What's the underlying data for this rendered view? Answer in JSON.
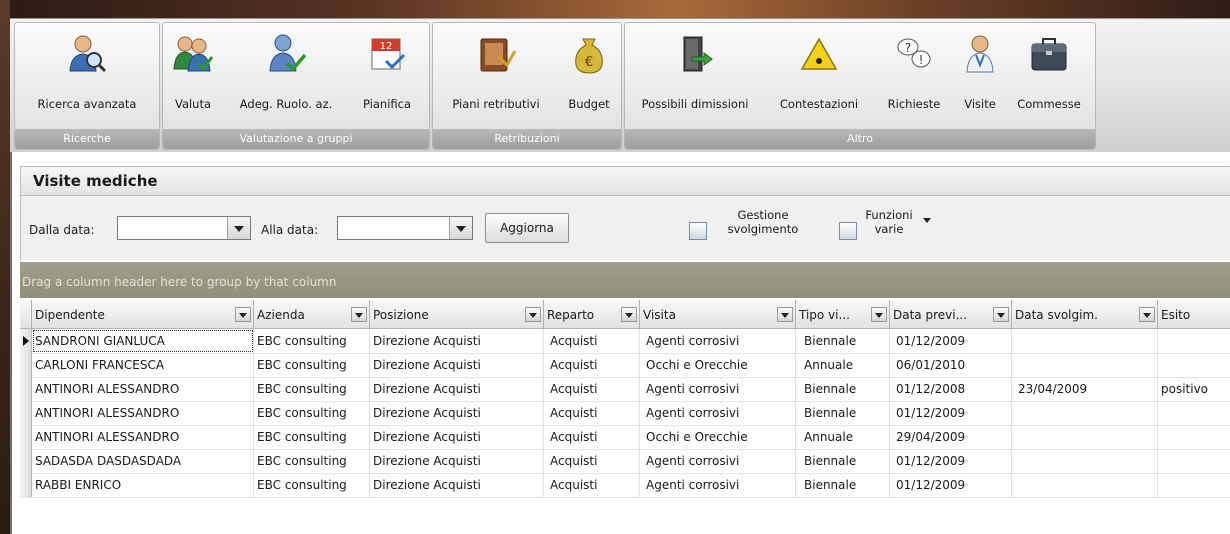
{
  "ribbon": {
    "groups": [
      {
        "title": "Ricerche",
        "buttons": [
          {
            "label": "Ricerca avanzata",
            "icon": "user-search-icon"
          }
        ]
      },
      {
        "title": "Valutazione a gruppi",
        "buttons": [
          {
            "label": "Valuta",
            "icon": "users-evaluate-icon"
          },
          {
            "label": "Adeg. Ruolo. az.",
            "icon": "user-role-icon"
          },
          {
            "label": "Pianifica",
            "icon": "calendar-icon"
          }
        ]
      },
      {
        "title": "Retribuzioni",
        "buttons": [
          {
            "label": "Piani retributivi",
            "icon": "folder-pay-icon"
          },
          {
            "label": "Budget",
            "icon": "money-bag-icon"
          }
        ]
      },
      {
        "title": "Altro",
        "buttons": [
          {
            "label": "Possibili dimissioni",
            "icon": "exit-door-icon"
          },
          {
            "label": "Contestazioni",
            "icon": "warning-icon"
          },
          {
            "label": "Richieste",
            "icon": "question-bubbles-icon"
          },
          {
            "label": "Visite",
            "icon": "doctor-icon"
          },
          {
            "label": "Commesse",
            "icon": "briefcase-icon"
          }
        ]
      }
    ]
  },
  "panel": {
    "title": "Visite mediche",
    "from_label": "Dalla data:",
    "from_value": "",
    "to_label": "Alla data:",
    "to_value": "",
    "refresh_label": "Aggiorna",
    "gestione_line1": "Gestione",
    "gestione_line2": "svolgimento",
    "funzioni_line1": "Funzioni",
    "funzioni_line2": "varie"
  },
  "grid": {
    "group_hint": "Drag a column header here to group by that column",
    "columns": [
      "Dipendente",
      "Azienda",
      "Posizione",
      "Reparto",
      "Visita",
      "Tipo vi...",
      "Data previ...",
      "Data svolgim.",
      "Esito"
    ],
    "rows": [
      [
        "SANDRONI GIANLUCA",
        "EBC consulting",
        "Direzione Acquisti",
        "Acquisti",
        "Agenti corrosivi",
        "Biennale",
        "01/12/2009",
        "",
        ""
      ],
      [
        "CARLONI FRANCESCA",
        "EBC consulting",
        "Direzione Acquisti",
        "Acquisti",
        "Occhi e Orecchie",
        "Annuale",
        "06/01/2010",
        "",
        ""
      ],
      [
        "ANTINORI ALESSANDRO",
        "EBC consulting",
        "Direzione Acquisti",
        "Acquisti",
        "Agenti corrosivi",
        "Biennale",
        "01/12/2008",
        "23/04/2009",
        "positivo"
      ],
      [
        "ANTINORI ALESSANDRO",
        "EBC consulting",
        "Direzione Acquisti",
        "Acquisti",
        "Agenti corrosivi",
        "Biennale",
        "01/12/2009",
        "",
        ""
      ],
      [
        "ANTINORI ALESSANDRO",
        "EBC consulting",
        "Direzione Acquisti",
        "Acquisti",
        "Occhi e Orecchie",
        "Annuale",
        "29/04/2009",
        "",
        ""
      ],
      [
        "SADASDA DASDASDADA",
        "EBC consulting",
        "Direzione Acquisti",
        "Acquisti",
        "Agenti corrosivi",
        "Biennale",
        "01/12/2009",
        "",
        ""
      ],
      [
        "RABBI ENRICO",
        "EBC consulting",
        "Direzione Acquisti",
        "Acquisti",
        "Agenti corrosivi",
        "Biennale",
        "01/12/2009",
        "",
        ""
      ]
    ]
  }
}
